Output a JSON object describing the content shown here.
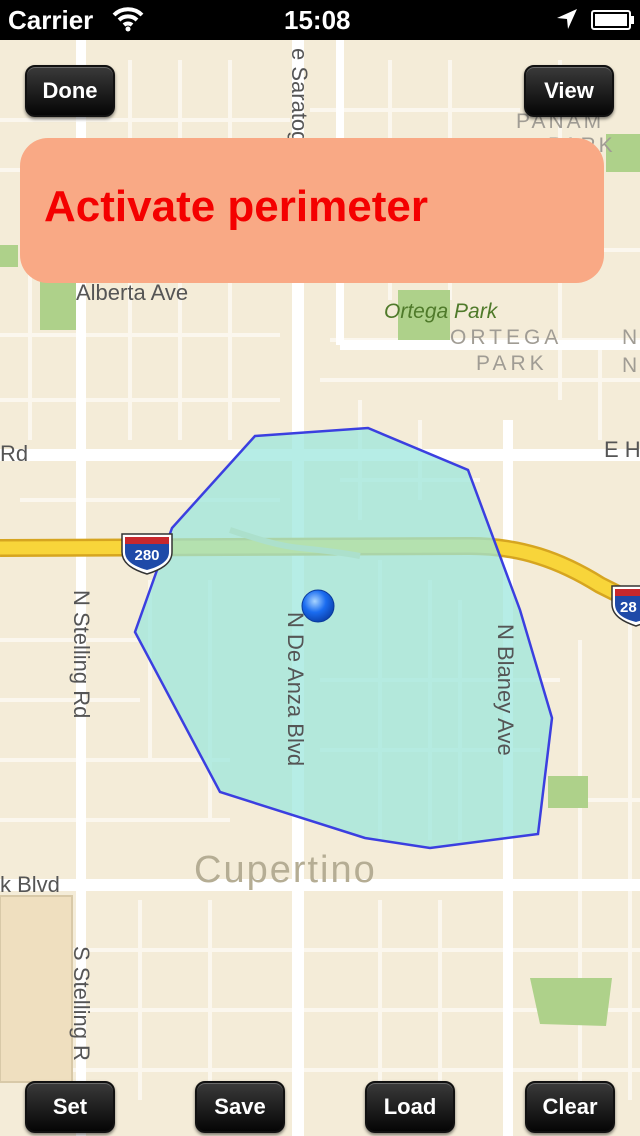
{
  "status_bar": {
    "carrier": "Carrier",
    "time": "15:08",
    "icons": [
      "wifi-icon",
      "location-arrow-icon",
      "battery-icon"
    ]
  },
  "toolbar_top": {
    "done_label": "Done",
    "view_label": "View"
  },
  "banner": {
    "text": "Activate perimeter",
    "text_color": "#f40000",
    "background_color": "#f9a985"
  },
  "map": {
    "streets": {
      "saratoga": "e Saratog",
      "alberta": "Alberta Ave",
      "rd_left": "Rd",
      "e_h": "E H",
      "n_stelling": "N Stelling Rd",
      "n_de_anza": "N De Anza Blvd",
      "n_blaney": "N Blaney Ave",
      "k_blvd": "k Blvd",
      "s_stelling": "S Stelling R"
    },
    "places": {
      "ortega_park": "Ortega Park",
      "ortega_district_1": "ORTEGA",
      "ortega_district_2": "PARK",
      "panama_1": "PANAM",
      "panama_2": "PARK",
      "n_right": "N",
      "cupertino": "Cupertino"
    },
    "highway_shields": [
      "280",
      "28"
    ],
    "perimeter_fill_color": "#9ae6dc",
    "perimeter_stroke_color": "#3b3fe0",
    "location_dot_color": "#1a6cf0"
  },
  "toolbar_bottom": {
    "set_label": "Set",
    "save_label": "Save",
    "load_label": "Load",
    "clear_label": "Clear"
  }
}
